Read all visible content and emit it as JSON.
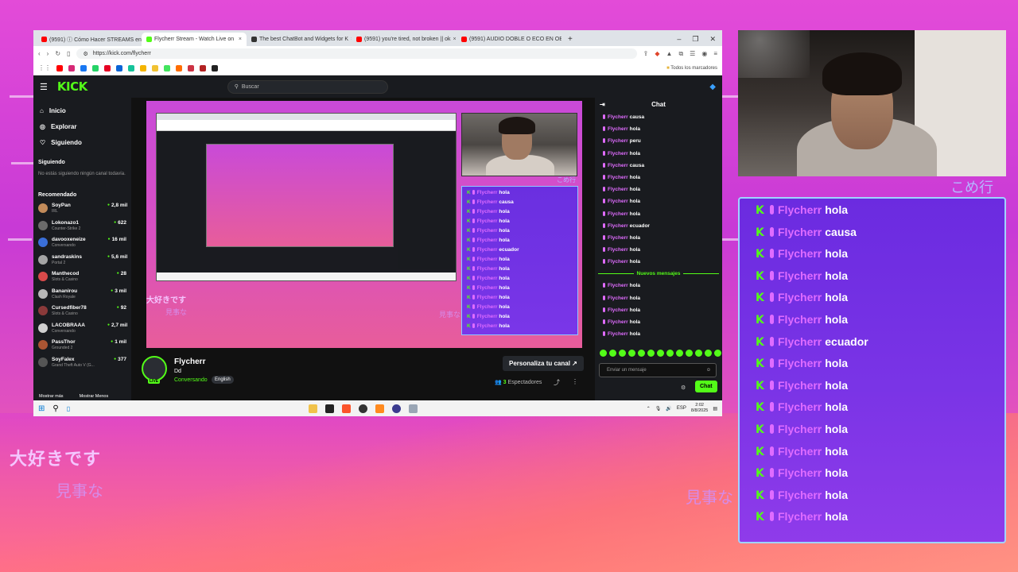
{
  "browser": {
    "tabs": [
      {
        "label": "(9591) ⓘ Cómo Hacer STREAMS en",
        "color": "#ff0000",
        "active": false
      },
      {
        "label": "Flycherr Stream - Watch Live on",
        "color": "#53fc18",
        "active": true
      },
      {
        "label": "The best ChatBot and Widgets for K",
        "color": "#333333",
        "active": false
      },
      {
        "label": "(9591) you're tired, not broken || ok",
        "color": "#ff0000",
        "active": false
      },
      {
        "label": "(9591) AUDIO DOBLE O ECO EN OBS",
        "color": "#ff0000",
        "active": false
      }
    ],
    "url": "https://kick.com/flycherr",
    "bookmarks_all": "Todos los marcadores"
  },
  "kick": {
    "logo": "KICK",
    "search_placeholder": "Buscar",
    "nav": [
      {
        "label": "Inicio",
        "icon": "home-icon"
      },
      {
        "label": "Explorar",
        "icon": "compass-icon"
      },
      {
        "label": "Siguiendo",
        "icon": "heart-icon"
      }
    ],
    "following_title": "Siguiendo",
    "following_empty": "No estás siguiendo ningún canal todavía.",
    "recommended_title": "Recomendado",
    "recommended": [
      {
        "name": "SoyPan",
        "category": "IRL",
        "viewers": "2,8 mil",
        "color": "#c28b5a"
      },
      {
        "name": "Lokonazo1",
        "category": "Counter-Strike 2",
        "viewers": "622",
        "color": "#6b6b6b"
      },
      {
        "name": "davooxeneize",
        "category": "Conversando",
        "viewers": "16 mil",
        "color": "#3a6fd8"
      },
      {
        "name": "sandraskins",
        "category": "Portal 2",
        "viewers": "5,6 mil",
        "color": "#a4a4a4"
      },
      {
        "name": "Manthecod",
        "category": "Slots & Casino",
        "viewers": "28",
        "color": "#d84a4a"
      },
      {
        "name": "Bananirou",
        "category": "Clash Royale",
        "viewers": "3 mil",
        "color": "#b7b7b7"
      },
      {
        "name": "Cursedfiber78",
        "category": "Slots & Casino",
        "viewers": "92",
        "color": "#8a3a3a"
      },
      {
        "name": "LACOBRAAA",
        "category": "Conversando",
        "viewers": "2,7 mil",
        "color": "#d0d0d0"
      },
      {
        "name": "PassThor",
        "category": "Grounded 2",
        "viewers": "1 mil",
        "color": "#aa5533"
      },
      {
        "name": "SoyFalex",
        "category": "Grand Theft Auto V (G...",
        "viewers": "377",
        "color": "#555555"
      }
    ],
    "show_more": "Mostrar más",
    "show_less": "Mostrar Menos",
    "stream": {
      "name": "Flycherr",
      "title": "Dd",
      "category": "Conversando",
      "language": "English",
      "live_badge": "LIVE",
      "customize": "Personaliza tu canal",
      "viewers_count": "3",
      "viewers_label": "Espectadores"
    },
    "chat": {
      "title": "Chat",
      "messages_before": [
        {
          "user": "Flycherr",
          "text": "causa"
        },
        {
          "user": "Flycherr",
          "text": "hola"
        },
        {
          "user": "Flycherr",
          "text": "peru"
        },
        {
          "user": "Flycherr",
          "text": "hola"
        },
        {
          "user": "Flycherr",
          "text": "causa"
        },
        {
          "user": "Flycherr",
          "text": "hola"
        },
        {
          "user": "Flycherr",
          "text": "hola"
        },
        {
          "user": "Flycherr",
          "text": "hola"
        },
        {
          "user": "Flycherr",
          "text": "hola"
        },
        {
          "user": "Flycherr",
          "text": "ecuador"
        },
        {
          "user": "Flycherr",
          "text": "hola"
        },
        {
          "user": "Flycherr",
          "text": "hola"
        },
        {
          "user": "Flycherr",
          "text": "hola"
        }
      ],
      "new_messages_label": "Nuevos mensajes",
      "messages_after": [
        {
          "user": "Flycherr",
          "text": "hola"
        },
        {
          "user": "Flycherr",
          "text": "hola"
        },
        {
          "user": "Flycherr",
          "text": "hola"
        },
        {
          "user": "Flycherr",
          "text": "hola"
        },
        {
          "user": "Flycherr",
          "text": "hola"
        }
      ],
      "input_placeholder": "Enviar un mensaje",
      "send_label": "Chat"
    }
  },
  "player_overlay": {
    "jp_big": "大好きです",
    "jp_small": "見事な",
    "jp_corner": "こめ行",
    "mini_chat": [
      {
        "user": "Flycherr",
        "text": "hola"
      },
      {
        "user": "Flycherr",
        "text": "causa"
      },
      {
        "user": "Flycherr",
        "text": "hola"
      },
      {
        "user": "Flycherr",
        "text": "hola"
      },
      {
        "user": "Flycherr",
        "text": "hola"
      },
      {
        "user": "Flycherr",
        "text": "hola"
      },
      {
        "user": "Flycherr",
        "text": "ecuador"
      },
      {
        "user": "Flycherr",
        "text": "hola"
      },
      {
        "user": "Flycherr",
        "text": "hola"
      },
      {
        "user": "Flycherr",
        "text": "hola"
      },
      {
        "user": "Flycherr",
        "text": "hola"
      },
      {
        "user": "Flycherr",
        "text": "hola"
      },
      {
        "user": "Flycherr",
        "text": "hola"
      },
      {
        "user": "Flycherr",
        "text": "hola"
      },
      {
        "user": "Flycherr",
        "text": "hola"
      }
    ]
  },
  "taskbar": {
    "lang": "ESP",
    "time": "2:02",
    "date": "8/8/2025"
  },
  "overlay": {
    "jp_big": "大好きです",
    "jp_small": "見事な",
    "jp_right": "見事な",
    "jp_corner": "こめ行",
    "chat": [
      {
        "user": "Flycherr",
        "text": "hola"
      },
      {
        "user": "Flycherr",
        "text": "causa"
      },
      {
        "user": "Flycherr",
        "text": "hola"
      },
      {
        "user": "Flycherr",
        "text": "hola"
      },
      {
        "user": "Flycherr",
        "text": "hola"
      },
      {
        "user": "Flycherr",
        "text": "hola"
      },
      {
        "user": "Flycherr",
        "text": "ecuador"
      },
      {
        "user": "Flycherr",
        "text": "hola"
      },
      {
        "user": "Flycherr",
        "text": "hola"
      },
      {
        "user": "Flycherr",
        "text": "hola"
      },
      {
        "user": "Flycherr",
        "text": "hola"
      },
      {
        "user": "Flycherr",
        "text": "hola"
      },
      {
        "user": "Flycherr",
        "text": "hola"
      },
      {
        "user": "Flycherr",
        "text": "hola"
      },
      {
        "user": "Flycherr",
        "text": "hola"
      }
    ],
    "badge_letter": "K"
  },
  "colors": {
    "kick_green": "#53fc18",
    "username_pink": "#e06cff",
    "chat_purple": "#7a34e6",
    "background_magenta": "#d84ad0"
  }
}
